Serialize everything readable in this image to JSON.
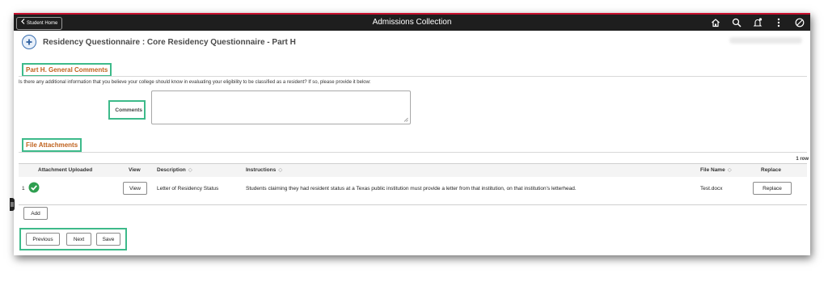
{
  "topbar": {
    "home_label": "Student Home",
    "title": "Admissions Collection",
    "icons": [
      "home-icon",
      "search-icon",
      "bell-icon",
      "more-icon",
      "nav-icon"
    ]
  },
  "header": {
    "title": "Residency Questionnaire : Core Residency Questionnaire - Part H"
  },
  "part_h": {
    "title": "Part H. General Comments",
    "question": "Is there any additional information that you believe your college should know in evaluating your eligibility to be classified as a resident? If so, please provide it below:",
    "comments_label": "Comments",
    "comments_value": ""
  },
  "attachments": {
    "title": "File Attachments",
    "row_count": "1 row",
    "columns": {
      "uploaded": "Attachment Uploaded",
      "view": "View",
      "description": "Description",
      "instructions": "Instructions",
      "file_name": "File Name",
      "replace": "Replace"
    },
    "rows": [
      {
        "num": "1",
        "view_label": "View",
        "description": "Letter of Residency Status",
        "instructions": "Students claiming they had resident status at a Texas public institution must provide a letter from that institution, on that institution's letterhead.",
        "file_name": "Test.docx",
        "replace_label": "Replace"
      }
    ],
    "add_label": "Add"
  },
  "nav": {
    "previous_label": "Previous",
    "next_label": "Next",
    "save_label": "Save"
  },
  "colors": {
    "accent_orange": "#c0621e",
    "highlight_green": "#3dba8a",
    "topbar": "#1e1e1e",
    "check_green": "#2e9e4f"
  }
}
